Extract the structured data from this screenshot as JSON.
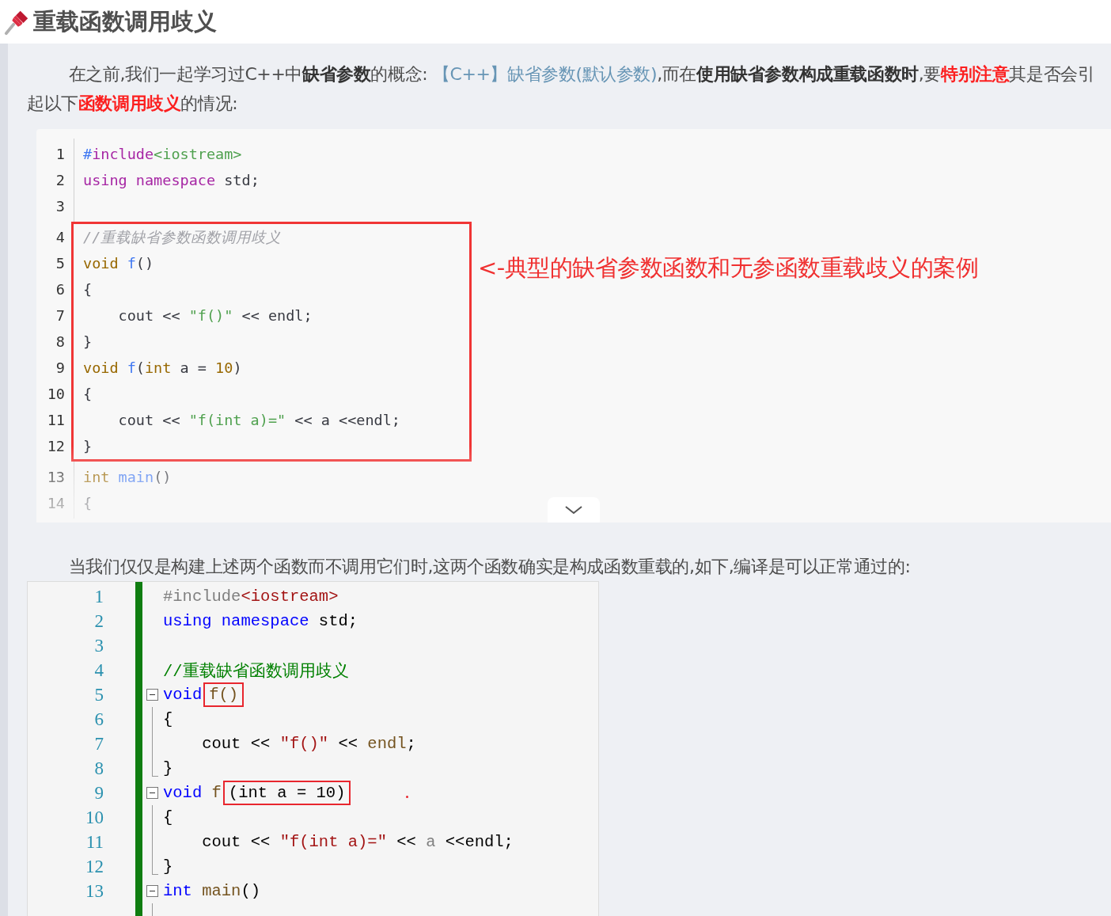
{
  "heading": {
    "title": "重载函数调用歧义"
  },
  "intro": [
    {
      "text": "在之前,我们一起学习过C++中",
      "kind": "plain"
    },
    {
      "text": "缺省参数",
      "kind": "bold"
    },
    {
      "text": "的概念: ",
      "kind": "plain"
    },
    {
      "text": "【C++】缺省参数(默认参数)",
      "kind": "link"
    },
    {
      "text": ",而在",
      "kind": "plain"
    },
    {
      "text": "使用缺省参数构成重载函数时",
      "kind": "bold"
    },
    {
      "text": ",要",
      "kind": "plain"
    },
    {
      "text": "特别注意",
      "kind": "red"
    },
    {
      "text": "其是否会引起以下",
      "kind": "plain"
    },
    {
      "text": "函数调用歧义",
      "kind": "red"
    },
    {
      "text": "的情况:",
      "kind": "plain"
    }
  ],
  "code_block": {
    "groups": [
      {
        "boxed": false,
        "lines": [
          {
            "number": "1",
            "tokens": [
              {
                "text": "#",
                "kind": "fn"
              },
              {
                "text": "include",
                "kind": "kw"
              },
              {
                "text": "<iostream>",
                "kind": "str"
              }
            ]
          },
          {
            "number": "2",
            "tokens": [
              {
                "text": "using namespace",
                "kind": "kw"
              },
              {
                "text": " std;",
                "kind": "plain"
              }
            ]
          },
          {
            "number": "3"
          }
        ]
      },
      {
        "boxed": true,
        "lines": [
          {
            "number": "4",
            "tokens": [
              {
                "text": "//重载缺省参数函数调用歧义",
                "kind": "com"
              }
            ]
          },
          {
            "number": "5",
            "tokens": [
              {
                "text": "void",
                "kind": "type"
              },
              {
                "text": " f",
                "kind": "fn"
              },
              {
                "text": "()",
                "kind": "plain"
              }
            ]
          },
          {
            "number": "6",
            "tokens": [
              {
                "text": "{",
                "kind": "plain"
              }
            ]
          },
          {
            "number": "7",
            "tokens": [
              {
                "text": "    cout << ",
                "kind": "plain"
              },
              {
                "text": "\"f()\"",
                "kind": "str"
              },
              {
                "text": " << endl;",
                "kind": "plain"
              }
            ]
          },
          {
            "number": "8",
            "tokens": [
              {
                "text": "}",
                "kind": "plain"
              }
            ]
          },
          {
            "number": "9",
            "tokens": [
              {
                "text": "void",
                "kind": "type"
              },
              {
                "text": " f",
                "kind": "fn"
              },
              {
                "text": "(",
                "kind": "plain"
              },
              {
                "text": "int",
                "kind": "type"
              },
              {
                "text": " a = ",
                "kind": "plain"
              },
              {
                "text": "10",
                "kind": "num"
              },
              {
                "text": ")",
                "kind": "plain"
              }
            ]
          },
          {
            "number": "10",
            "tokens": [
              {
                "text": "{",
                "kind": "plain"
              }
            ]
          },
          {
            "number": "11",
            "tokens": [
              {
                "text": "    cout << ",
                "kind": "plain"
              },
              {
                "text": "\"f(int a)=\"",
                "kind": "str"
              },
              {
                "text": " << a <<endl;",
                "kind": "plain"
              }
            ]
          },
          {
            "number": "12",
            "tokens": [
              {
                "text": "}",
                "kind": "plain"
              }
            ]
          }
        ]
      },
      {
        "boxed": false,
        "lines": [
          {
            "number": "13",
            "tokens": [
              {
                "text": "int",
                "kind": "type"
              },
              {
                "text": " main",
                "kind": "fn"
              },
              {
                "text": "()",
                "kind": "plain"
              }
            ]
          },
          {
            "number": "14",
            "tokens": [
              {
                "text": "{",
                "kind": "plain"
              }
            ]
          }
        ]
      }
    ]
  },
  "annotation": "<-典型的缺省参数函数和无参函数重载歧义的案例",
  "explanation": "当我们仅仅是构建上述两个函数而不调用它们时,这两个函数确实是构成函数重载的,如下,编译是可以正常通过的:",
  "editor": {
    "lines": [
      {
        "number": "1",
        "kind": "plain",
        "tokens": [
          {
            "text": "#include",
            "kind": "pre"
          },
          {
            "text": "<iostream>",
            "kind": "inc"
          }
        ]
      },
      {
        "number": "2",
        "kind": "plain",
        "tokens": [
          {
            "text": "using",
            "kind": "kw"
          },
          {
            "text": " namespace",
            "kind": "kw"
          },
          {
            "text": " std;",
            "kind": "plain"
          }
        ]
      },
      {
        "number": "3",
        "kind": "plain"
      },
      {
        "number": "4",
        "kind": "plain",
        "tokens": [
          {
            "text": "//重载缺省函数调用歧义",
            "kind": "com"
          }
        ]
      },
      {
        "number": "5",
        "kind": "start",
        "tokens": [
          {
            "text": "void",
            "kind": "kw"
          },
          {
            "text": "f()",
            "kind": "fn",
            "boxed": true
          }
        ]
      },
      {
        "number": "6",
        "kind": "body",
        "tokens": [
          {
            "text": "{",
            "kind": "plain"
          }
        ]
      },
      {
        "number": "7",
        "kind": "body",
        "tokens": [
          {
            "text": "    cout << ",
            "kind": "plain"
          },
          {
            "text": "\"f()\"",
            "kind": "str"
          },
          {
            "text": " << ",
            "kind": "plain"
          },
          {
            "text": "endl",
            "kind": "fn"
          },
          {
            "text": ";",
            "kind": "plain"
          }
        ]
      },
      {
        "number": "8",
        "kind": "end",
        "tokens": [
          {
            "text": "}",
            "kind": "plain"
          }
        ]
      },
      {
        "number": "9",
        "kind": "start",
        "tokens": [
          {
            "text": "void",
            "kind": "kw"
          },
          {
            "text": " f",
            "kind": "fn"
          },
          {
            "text": "(int a = 10)",
            "kind": "param",
            "boxed": true
          }
        ]
      },
      {
        "number": "10",
        "kind": "body",
        "tokens": [
          {
            "text": "{",
            "kind": "plain"
          }
        ]
      },
      {
        "number": "11",
        "kind": "body",
        "tokens": [
          {
            "text": "    cout << ",
            "kind": "plain"
          },
          {
            "text": "\"f(int a)=\"",
            "kind": "str"
          },
          {
            "text": " << ",
            "kind": "plain"
          },
          {
            "text": "a",
            "kind": "var"
          },
          {
            "text": " <<endl;",
            "kind": "plain"
          }
        ]
      },
      {
        "number": "12",
        "kind": "end",
        "tokens": [
          {
            "text": "}",
            "kind": "plain"
          }
        ]
      },
      {
        "number": "13",
        "kind": "start",
        "tokens": [
          {
            "text": "int",
            "kind": "kw"
          },
          {
            "text": " main",
            "kind": "fn"
          },
          {
            "text": "()",
            "kind": "plain"
          }
        ]
      }
    ]
  }
}
